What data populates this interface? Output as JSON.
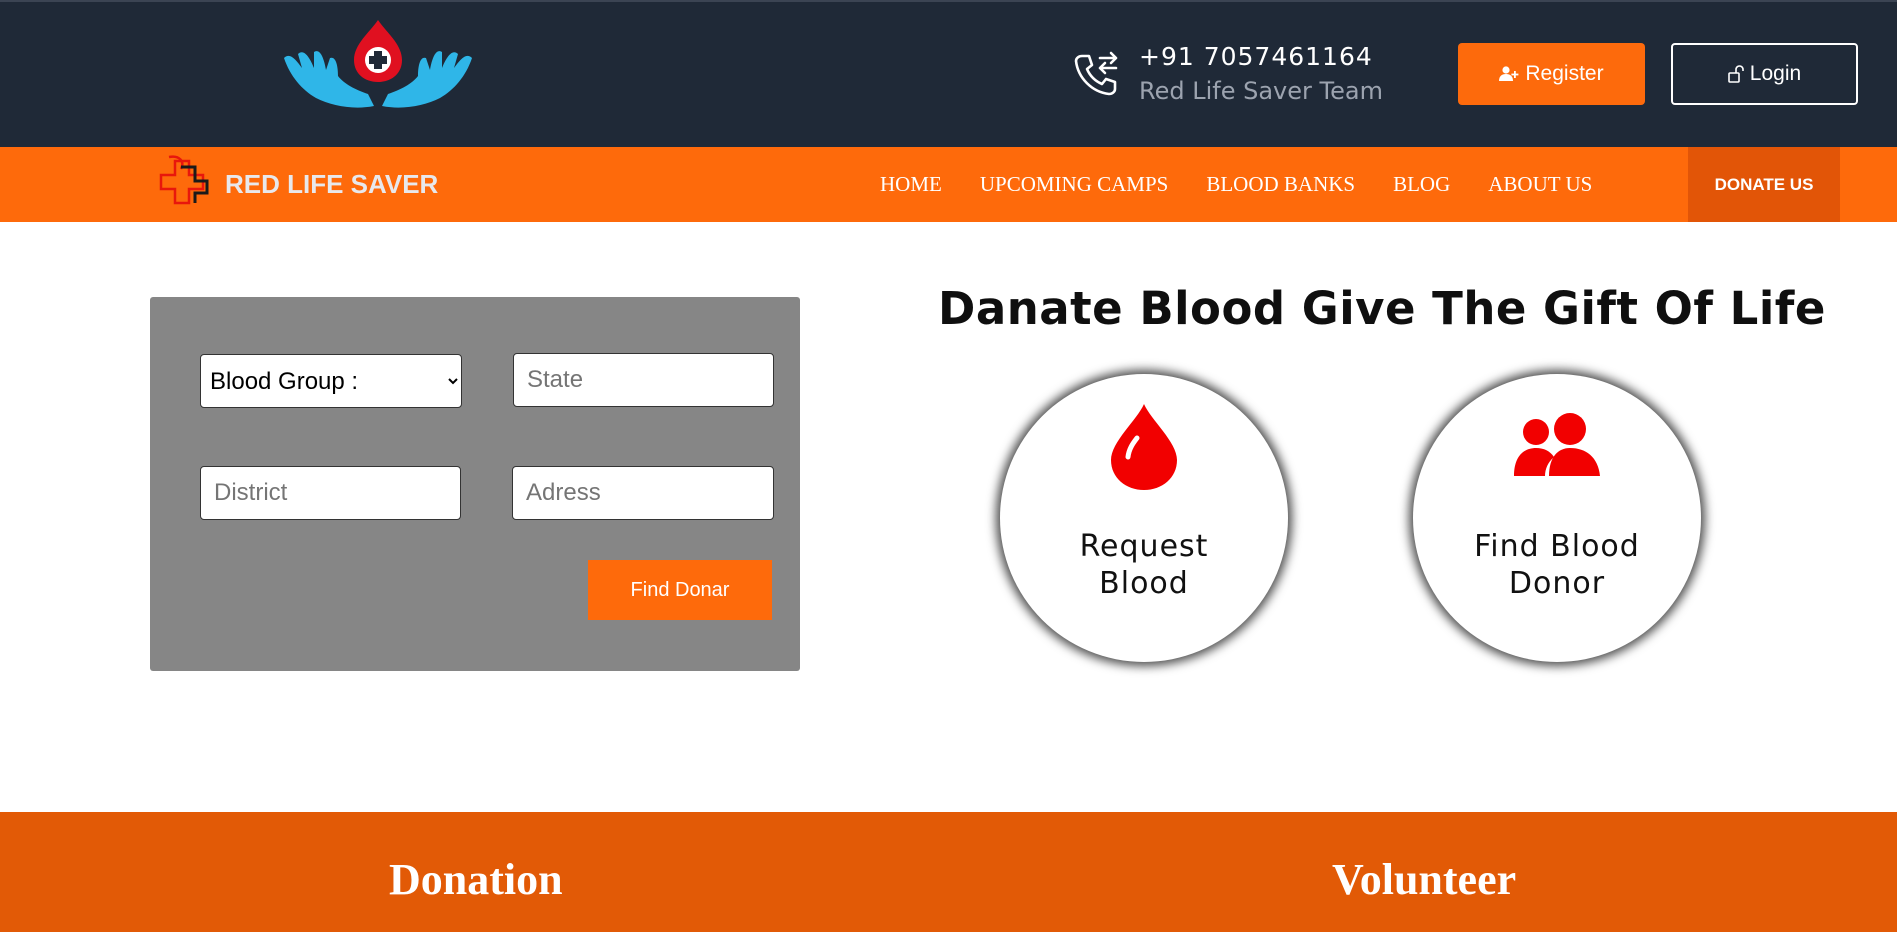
{
  "header": {
    "phone_number": "+91 7057461164",
    "team_name": "Red Life Saver Team",
    "register_label": "Register",
    "login_label": "Login",
    "icons": {
      "logo": "hands-holding-blood-drop-logo",
      "phone": "phone-transfer-icon",
      "register": "user-plus-icon",
      "login": "unlock-icon"
    }
  },
  "nav": {
    "brand_name": "RED LIFE SAVER",
    "links": [
      "HOME",
      "UPCOMING CAMPS",
      "BLOOD BANKS",
      "BLOG",
      "ABOUT US"
    ],
    "donate_label": "DONATE US"
  },
  "search": {
    "blood_group_selected": "Blood Group :",
    "state_placeholder": "State",
    "district_placeholder": "District",
    "address_placeholder": "Adress",
    "find_label": "Find Donar"
  },
  "hero": {
    "headline": "Danate Blood Give The Gift Of Life",
    "cards": [
      {
        "line1": "Request",
        "line2": "Blood",
        "icon": "blood-drop-icon"
      },
      {
        "line1": "Find Blood",
        "line2": "Donor",
        "icon": "users-icon"
      }
    ]
  },
  "bottom": {
    "donation_title": "Donation",
    "volunteer_title": "Volunteer"
  },
  "colors": {
    "header_bg": "#1f2937",
    "accent_orange": "#fe6a0b",
    "dark_orange": "#e25507",
    "icon_red": "#f20000",
    "logo_blue": "#2fb6e8",
    "panel_gray": "#868686"
  }
}
